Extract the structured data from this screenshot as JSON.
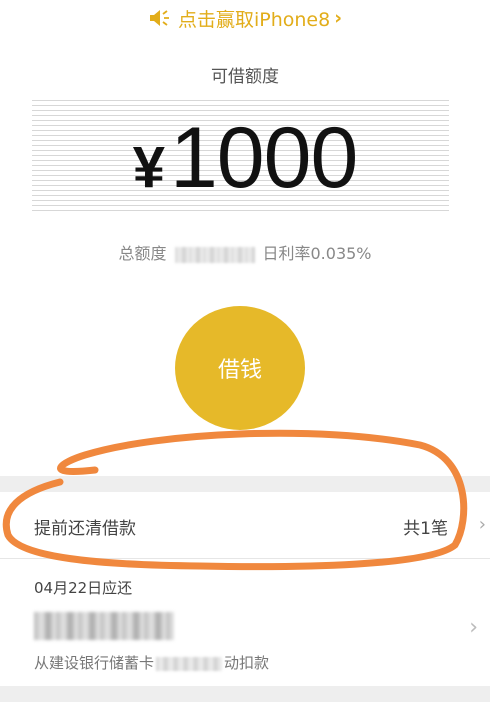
{
  "promo": {
    "text": "点击赢取iPhone8",
    "chevron": "›",
    "icon": "speaker-icon"
  },
  "credit": {
    "label": "可借额度",
    "currency": "¥",
    "amount": "1000",
    "total_label": "总额度",
    "rate_text": "日利率0.035%"
  },
  "borrow_button": {
    "label": "借钱"
  },
  "repay": {
    "label": "提前还清借款",
    "count": "共1笔",
    "arrow": "›"
  },
  "due": {
    "date": "04月22日应还",
    "desc_prefix": "从建设银行储蓄卡",
    "desc_suffix": "动扣款",
    "arrow": "›"
  },
  "colors": {
    "accent": "#e6b929",
    "promo": "#e2ad1a",
    "annotation": "#f0883e"
  }
}
